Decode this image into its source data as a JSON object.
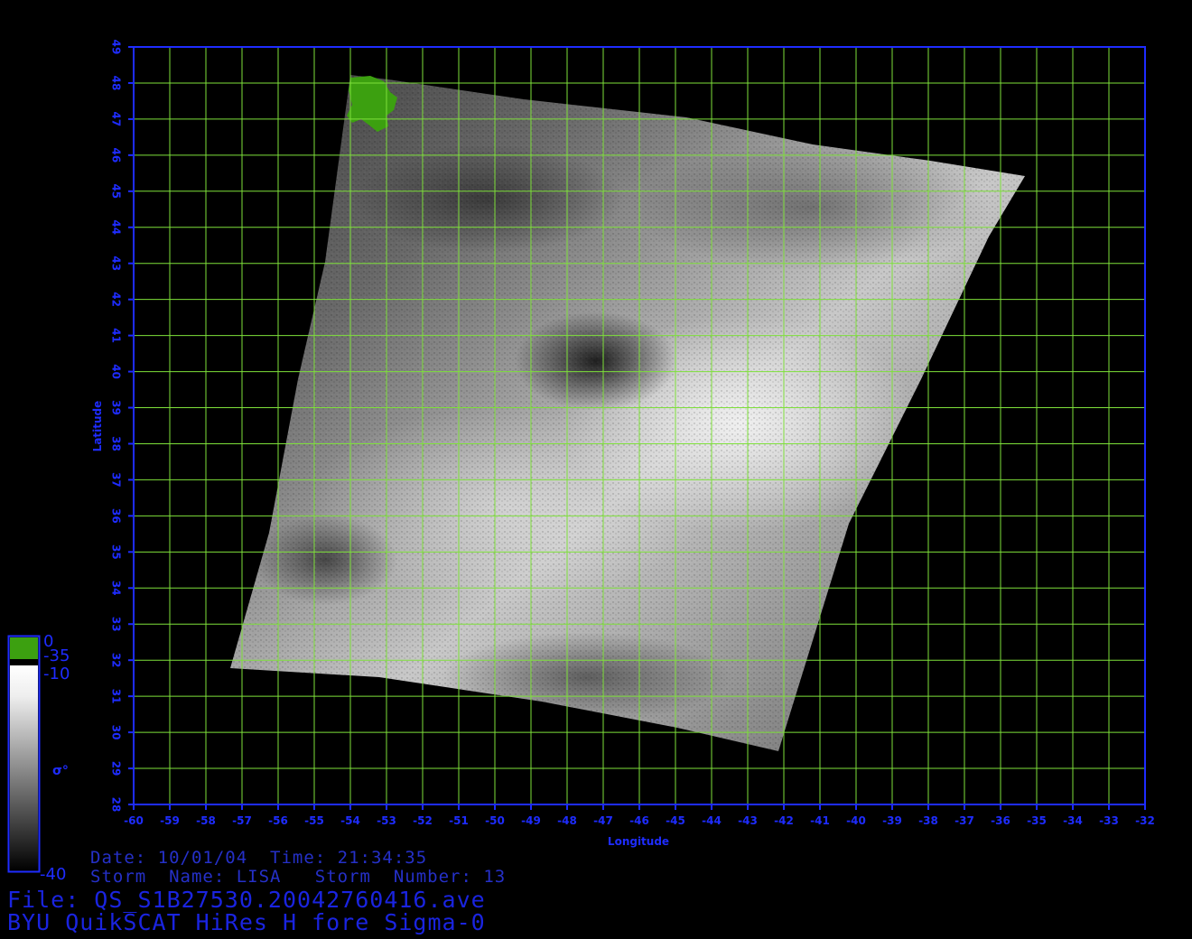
{
  "plot": {
    "x_axis_label": "Longitude",
    "y_axis_label": "Latitude",
    "x_ticks": [
      "-60",
      "-59",
      "-58",
      "-57",
      "-56",
      "-55",
      "-54",
      "-53",
      "-52",
      "-51",
      "-50",
      "-49",
      "-48",
      "-47",
      "-46",
      "-45",
      "-44",
      "-43",
      "-42",
      "-41",
      "-40",
      "-39",
      "-38",
      "-37",
      "-36",
      "-35",
      "-34",
      "-33",
      "-32"
    ],
    "y_ticks": [
      "28",
      "29",
      "30",
      "31",
      "32",
      "33",
      "34",
      "35",
      "36",
      "37",
      "38",
      "39",
      "40",
      "41",
      "42",
      "43",
      "44",
      "45",
      "46",
      "47",
      "48",
      "49"
    ],
    "grid_color": "#7ee03a",
    "axis_color": "#1e2cff"
  },
  "colorbar": {
    "labels": [
      "0",
      "-35",
      "-10",
      "-40"
    ],
    "symbol": "σ°",
    "land_color": "#3ca010"
  },
  "info": {
    "date_time": "Date: 10/01/04  Time: 21:34:35",
    "storm": "Storm  Name: LISA   Storm  Number: 13",
    "file": "File: QS_S1B27530.20042760416.ave",
    "product": "BYU QuikSCAT HiRes H fore Sigma-0"
  }
}
